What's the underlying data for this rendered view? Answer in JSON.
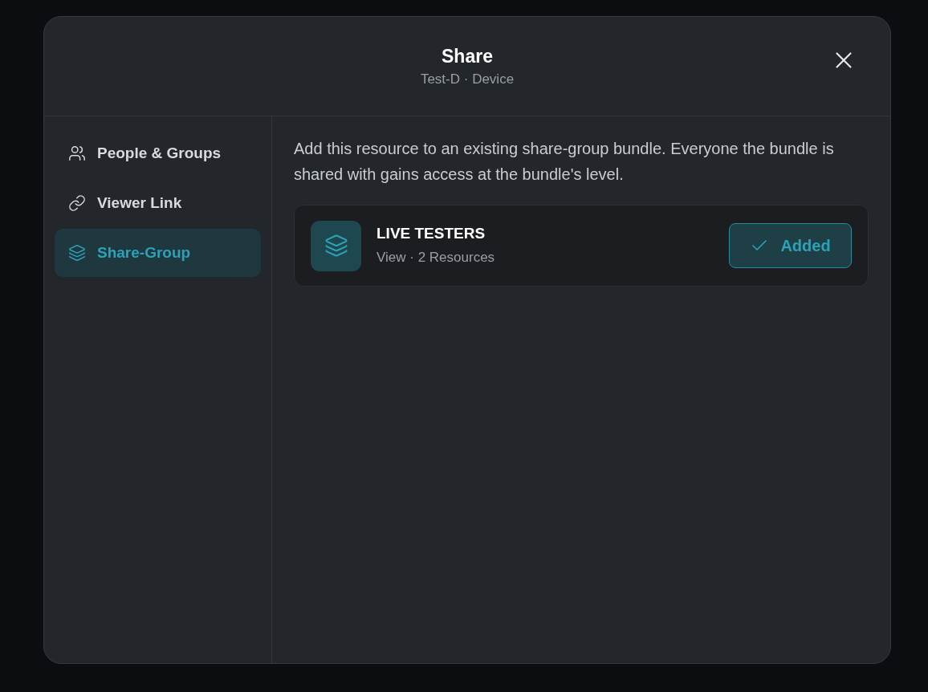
{
  "dialog": {
    "title": "Share",
    "subtitle": "Test-D · Device"
  },
  "sidebar": {
    "items": [
      {
        "label": "People & Groups",
        "kind": "people",
        "selected": false
      },
      {
        "label": "Viewer Link",
        "kind": "link",
        "selected": false
      },
      {
        "label": "Share-Group",
        "kind": "layers",
        "selected": true
      }
    ]
  },
  "content": {
    "description": "Add this resource to an existing share-group bundle. Everyone the bundle is shared with gains access at the bundle's level.",
    "groups": [
      {
        "name": "LIVE TESTERS",
        "meta": "View · 2 Resources",
        "added": true,
        "action_label": "Added"
      }
    ]
  }
}
